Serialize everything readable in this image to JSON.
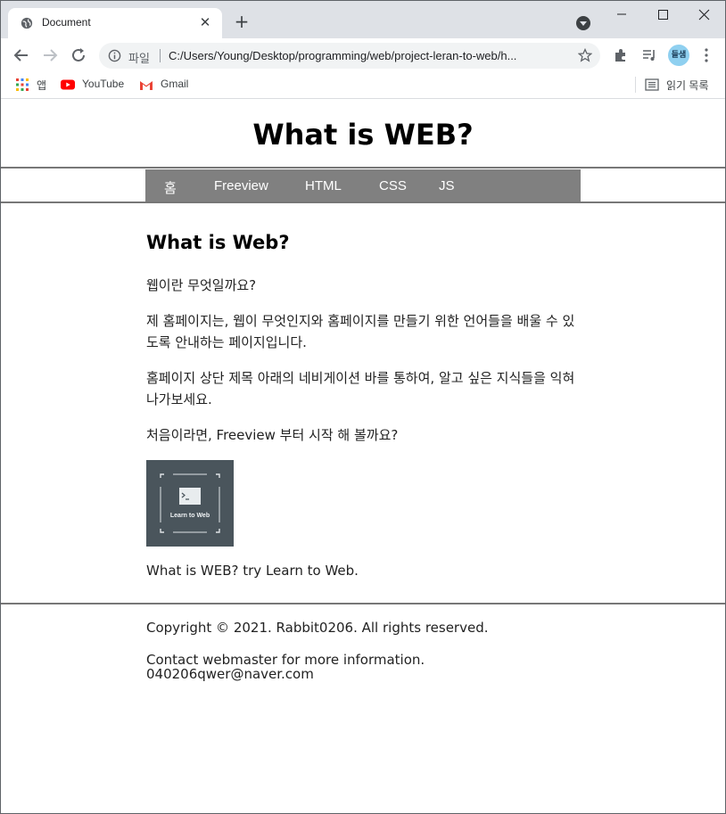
{
  "browser": {
    "tab_title": "Document",
    "url_scheme": "파일",
    "url": "C:/Users/Young/Desktop/programming/web/project-leran-to-web/h...",
    "profile": "들샘",
    "bookmarks": [
      {
        "label": "앱",
        "icon": "apps-grid-icon"
      },
      {
        "label": "YouTube",
        "icon": "youtube-icon"
      },
      {
        "label": "Gmail",
        "icon": "gmail-icon"
      }
    ],
    "reading_list": "읽기 목록"
  },
  "page": {
    "title": "What is WEB?",
    "nav": [
      "홈",
      "Freeview",
      "HTML",
      "CSS",
      "JS"
    ],
    "heading": "What is Web?",
    "paragraphs": [
      "웹이란 무엇일까요?",
      "제 홈페이지는, 웹이 무엇인지와 홈페이지를 만들기 위한 언어들을 배울 수 있도록 안내하는 페이지입니다.",
      "홈페이지 상단 제목 아래의 네비게이션 바를 통하여, 알고 싶은 지식들을 익혀나가보세요.",
      "처음이라면, Freeview 부터 시작 해 볼까요?"
    ],
    "logo_text": "Learn to Web",
    "caption": "What is WEB? try Learn to Web.",
    "footer": {
      "copyright": "Copyright © 2021. Rabbit0206. All rights reserved.",
      "contact": "Contact webmaster for more information.",
      "email": "040206qwer@naver.com"
    }
  }
}
